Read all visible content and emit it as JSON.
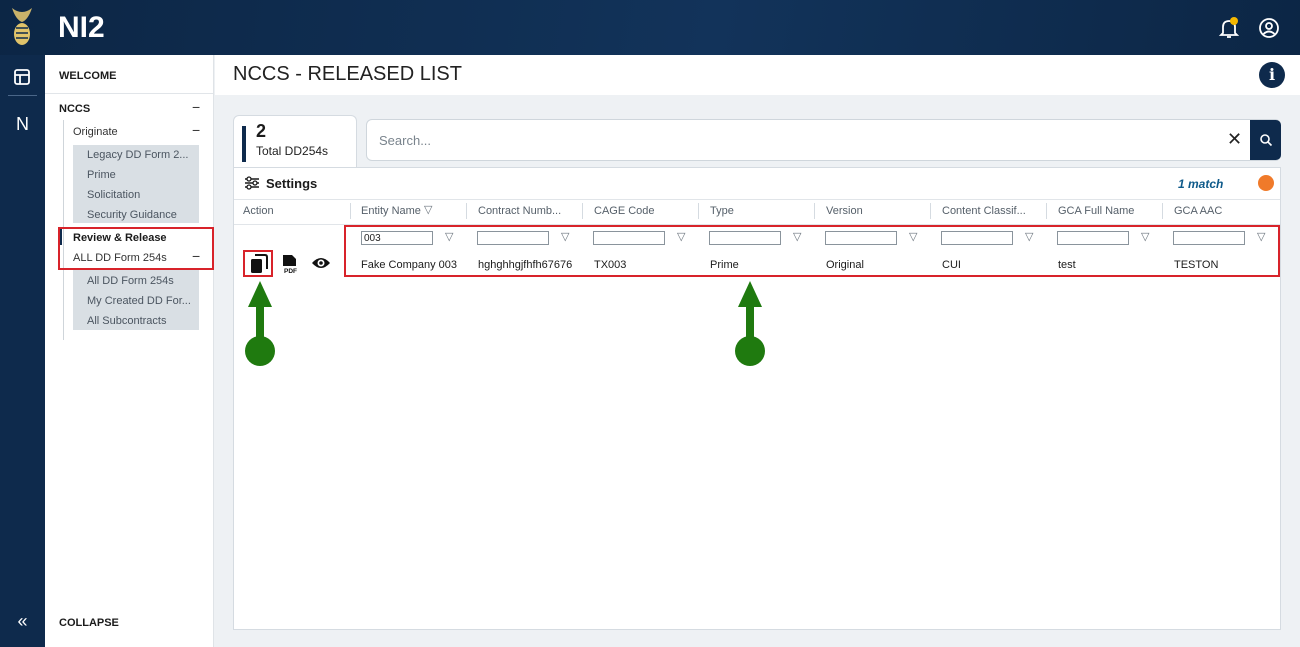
{
  "app": {
    "title": "NI2"
  },
  "rail": {
    "n_label": "N"
  },
  "sidebar": {
    "welcome": "WELCOME",
    "nccs": "NCCS",
    "originate": "Originate",
    "originate_items": [
      "Legacy DD Form 2...",
      "Prime",
      "Solicitation",
      "Security Guidance"
    ],
    "review_release": "Review & Release",
    "all_dd_form": "ALL DD Form 254s",
    "review_items": [
      "All DD Form 254s",
      "My Created DD For...",
      "All Subcontracts"
    ],
    "collapse": "COLLAPSE"
  },
  "page": {
    "title": "NCCS - RELEASED LIST"
  },
  "count": {
    "value": "2",
    "label": "Total DD254s"
  },
  "search": {
    "placeholder": "Search...",
    "value": ""
  },
  "table": {
    "settings_label": "Settings",
    "match_label": "1 match",
    "columns": [
      "Action",
      "Entity Name",
      "Contract Numb...",
      "CAGE Code",
      "Type",
      "Version",
      "Content Classif...",
      "GCA Full Name",
      "GCA AAC"
    ],
    "filters": [
      "003",
      "",
      "",
      "",
      "",
      "",
      "",
      ""
    ],
    "rows": [
      {
        "entity_name": "Fake Company 003",
        "contract_number": "hghghhgjfhfh67676",
        "cage_code": "TX003",
        "type": "Prime",
        "version": "Original",
        "content_classification": "CUI",
        "gca_full_name": "test",
        "gca_aac": "TESTON"
      }
    ]
  },
  "colors": {
    "navy": "#0e2a4c",
    "highlight_red": "#d8232a",
    "arrow_green": "#1f7a0f",
    "notification_dot": "#f5b800",
    "match_badge": "#f07a2a"
  }
}
